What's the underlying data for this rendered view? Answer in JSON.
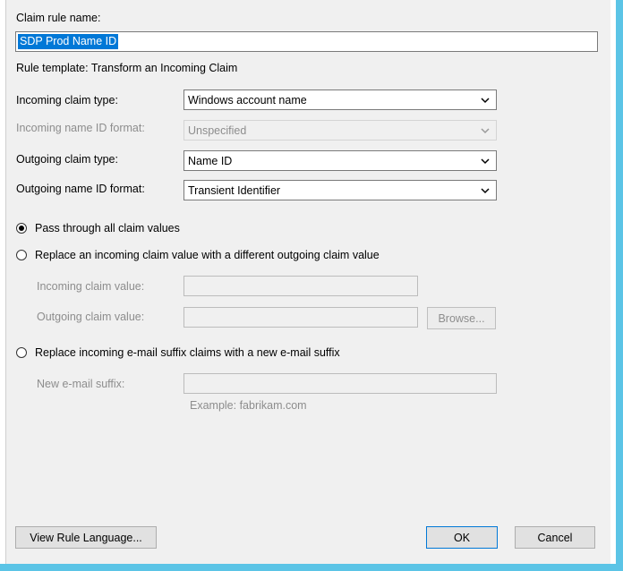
{
  "claim_rule_name": {
    "label": "Claim rule name:",
    "value": "SDP Prod Name ID"
  },
  "rule_template": "Rule template: Transform an Incoming Claim",
  "incoming_claim_type": {
    "label": "Incoming claim type:",
    "value": "Windows account name"
  },
  "incoming_name_id_format": {
    "label": "Incoming name ID format:",
    "value": "Unspecified"
  },
  "outgoing_claim_type": {
    "label": "Outgoing claim type:",
    "value": "Name ID"
  },
  "outgoing_name_id_format": {
    "label": "Outgoing name ID format:",
    "value": "Transient Identifier"
  },
  "options": {
    "pass_through": {
      "label": "Pass through all claim values",
      "selected": true
    },
    "replace_value": {
      "label": "Replace an incoming claim value with a different outgoing claim value",
      "selected": false
    },
    "replace_suffix": {
      "label": "Replace incoming e-mail suffix claims with a new e-mail suffix",
      "selected": false
    }
  },
  "incoming_claim_value": {
    "label": "Incoming claim value:",
    "value": ""
  },
  "outgoing_claim_value": {
    "label": "Outgoing claim value:",
    "value": ""
  },
  "browse_label": "Browse...",
  "new_email_suffix": {
    "label": "New e-mail suffix:",
    "value": ""
  },
  "example_text": "Example: fabrikam.com",
  "buttons": {
    "view_rule_language": "View Rule Language...",
    "ok": "OK",
    "cancel": "Cancel"
  },
  "colors": {
    "selection": "#0078d7",
    "window_border": "#5bc4e6",
    "dialog_bg": "#f0f0f0"
  }
}
